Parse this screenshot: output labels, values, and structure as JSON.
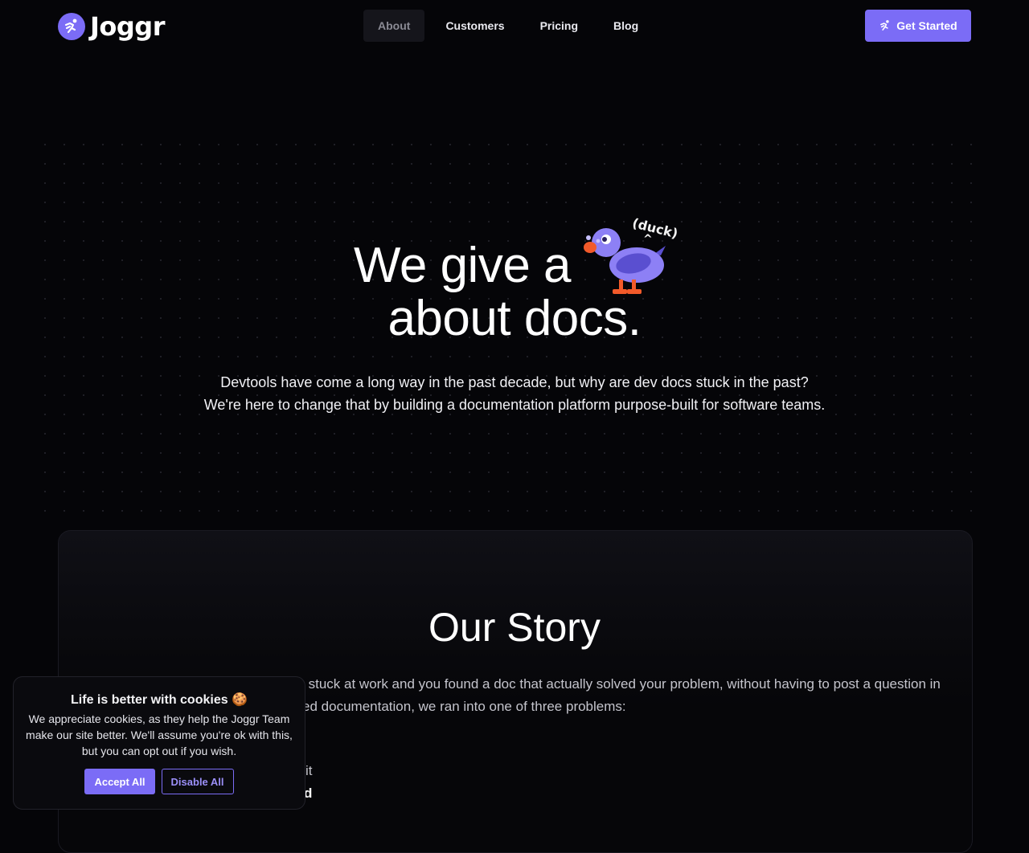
{
  "brand": {
    "name": "Joggr",
    "accent": "#7b6cf6"
  },
  "nav": {
    "links": [
      {
        "label": "About",
        "active": true
      },
      {
        "label": "Customers"
      },
      {
        "label": "Pricing"
      },
      {
        "label": "Blog"
      }
    ],
    "cta": "Get Started"
  },
  "hero": {
    "title_line1": "We give a",
    "title_line2": "about docs.",
    "duck_caption": "(duck)",
    "duck_caret": "^",
    "subtitle_line1": "Devtools have come a long way in the past decade, but why are dev docs stuck in the past?",
    "subtitle_line2": "We're here to change that by building a documentation platform purpose-built for software teams."
  },
  "story": {
    "title": "Our Story",
    "para_line1": "Think about the last time you were stuck at work and you found a doc that actually solved your problem, without having to post a question in",
    "para_line2": "Slack. For us, every time we needed documentation, we ran into one of three problems:",
    "item1_tail": "it",
    "item2_tail": "d"
  },
  "cookie": {
    "title": "Life is better with cookies 🍪",
    "text": "We appreciate cookies, as they help the Joggr Team make our site better. We'll assume you're ok with this, but you can opt out if you wish.",
    "accept": "Accept All",
    "disable": "Disable All"
  }
}
